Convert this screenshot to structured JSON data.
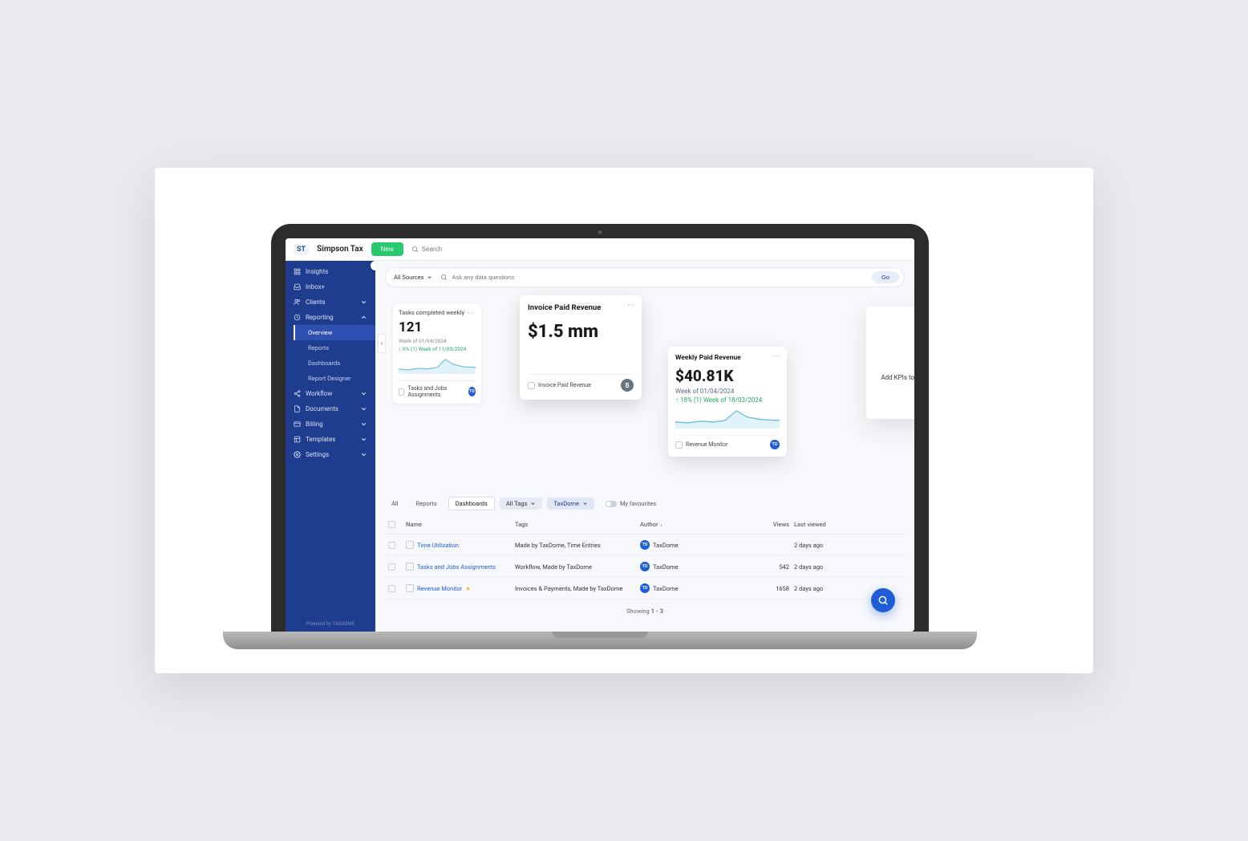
{
  "header": {
    "logo_text": "ST",
    "app_name": "Simpson Tax",
    "new_button": "New",
    "search_placeholder": "Search"
  },
  "sidebar": {
    "items": [
      {
        "label": "Insights",
        "icon": "grid"
      },
      {
        "label": "Inbox+",
        "icon": "inbox"
      },
      {
        "label": "Clients",
        "icon": "users",
        "expandable": true
      },
      {
        "label": "Reporting",
        "icon": "clock",
        "expandable": true,
        "expanded": true,
        "children": [
          {
            "label": "Overview",
            "active": true
          },
          {
            "label": "Reports"
          },
          {
            "label": "Dashboards"
          },
          {
            "label": "Report Designer"
          }
        ]
      },
      {
        "label": "Workflow",
        "icon": "share",
        "expandable": true
      },
      {
        "label": "Documents",
        "icon": "doc",
        "expandable": true
      },
      {
        "label": "Billing",
        "icon": "card",
        "expandable": true
      },
      {
        "label": "Templates",
        "icon": "layout",
        "expandable": true
      },
      {
        "label": "Settings",
        "icon": "gear",
        "expandable": true
      }
    ],
    "footer": "Powered by TAXDOME"
  },
  "query": {
    "source_label": "All Sources",
    "placeholder": "Ask any data questions",
    "go_label": "Go"
  },
  "kpi": {
    "tasks": {
      "title": "Tasks completed weekly",
      "value": "121",
      "week": "Week of 01/04/2024",
      "delta": "0% (1) Week of 11/03/2024",
      "footer": "Tasks and Jobs Assignments",
      "avatar": "TD"
    },
    "invoice": {
      "title": "Invoice Paid Revenue",
      "value": "$1.5 mm",
      "footer": "Invoice Paid Revenue",
      "avatar": "B"
    },
    "weekly": {
      "title": "Weekly Paid Revenue",
      "value": "$40.81K",
      "week": "Week of 01/04/2024",
      "delta": "18% (1) Week of 18/03/2024",
      "footer": "Revenue Monitor",
      "avatar": "TD"
    },
    "add": {
      "label": "Add KPIs to your watchlist"
    }
  },
  "filters": {
    "tabs": [
      "All",
      "Reports",
      "Dashboards"
    ],
    "active_tab": "Dashboards",
    "tags_label": "All Tags",
    "taxdome_label": "TaxDome",
    "fav_label": "My favourites"
  },
  "table": {
    "columns": [
      "Name",
      "Tags",
      "Author",
      "Views",
      "Last viewed"
    ],
    "rows": [
      {
        "name": "Time Utilization",
        "tags": "Made by TaxDome, Time Entries",
        "author": "TaxDome",
        "views": "",
        "last": "2 days ago",
        "fav": false
      },
      {
        "name": "Tasks and Jobs Assignments",
        "tags": "Workflow, Made by TaxDome",
        "author": "TaxDome",
        "views": "542",
        "last": "2 days ago",
        "fav": false
      },
      {
        "name": "Revenue Monitor",
        "tags": "Invoices & Payments, Made by TaxDome",
        "author": "TaxDome",
        "views": "1658",
        "last": "2 days ago",
        "fav": true
      }
    ]
  },
  "pager": {
    "prefix": "Showing ",
    "range": "1 - 3"
  },
  "chart_data": [
    {
      "type": "line",
      "name": "tasks-sparkline",
      "values": [
        15,
        12,
        18,
        14,
        22,
        58,
        30,
        24
      ],
      "range": [
        0,
        60
      ]
    },
    {
      "type": "line",
      "name": "revenue-sparkline",
      "values": [
        18,
        14,
        20,
        16,
        24,
        62,
        34,
        26
      ],
      "range": [
        0,
        65
      ]
    }
  ]
}
